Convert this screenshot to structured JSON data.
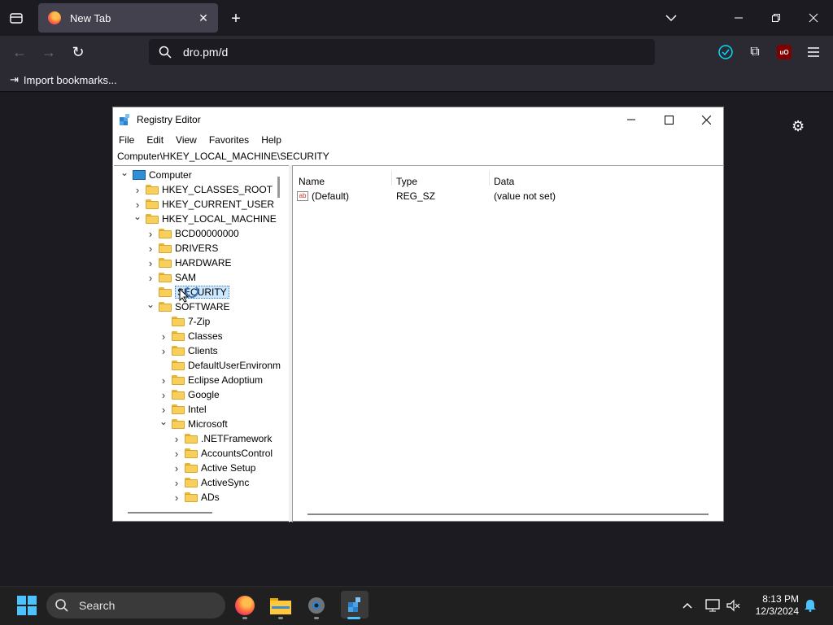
{
  "browser": {
    "tab_title": "New Tab",
    "url": "dro.pm/d",
    "bookmark_import": "Import bookmarks...",
    "colors": {
      "chrome_bg": "#1c1b22",
      "toolbar_bg": "#2b2a33",
      "accent": "#00ddff"
    }
  },
  "regedit": {
    "title": "Registry Editor",
    "menu": [
      "File",
      "Edit",
      "View",
      "Favorites",
      "Help"
    ],
    "address": "Computer\\HKEY_LOCAL_MACHINE\\SECURITY",
    "tree": [
      {
        "label": "Computer",
        "expanded": "down"
      },
      {
        "label": "HKEY_CLASSES_ROOT",
        "expanded": "right"
      },
      {
        "label": "HKEY_CURRENT_USER",
        "expanded": "right"
      },
      {
        "label": "HKEY_LOCAL_MACHINE",
        "expanded": "down"
      },
      {
        "label": "BCD00000000",
        "expanded": "right"
      },
      {
        "label": "DRIVERS",
        "expanded": "right"
      },
      {
        "label": "HARDWARE",
        "expanded": "right"
      },
      {
        "label": "SAM",
        "expanded": "right"
      },
      {
        "label": "SECURITY",
        "expanded": "none",
        "selected": true
      },
      {
        "label": "SOFTWARE",
        "expanded": "down"
      },
      {
        "label": "7-Zip",
        "expanded": "none"
      },
      {
        "label": "Classes",
        "expanded": "right"
      },
      {
        "label": "Clients",
        "expanded": "right"
      },
      {
        "label": "DefaultUserEnvironm",
        "expanded": "none"
      },
      {
        "label": "Eclipse Adoptium",
        "expanded": "right"
      },
      {
        "label": "Google",
        "expanded": "right"
      },
      {
        "label": "Intel",
        "expanded": "right"
      },
      {
        "label": "Microsoft",
        "expanded": "down"
      },
      {
        "label": ".NETFramework",
        "expanded": "right"
      },
      {
        "label": "AccountsControl",
        "expanded": "right"
      },
      {
        "label": "Active Setup",
        "expanded": "right"
      },
      {
        "label": "ActiveSync",
        "expanded": "right"
      },
      {
        "label": "ADs",
        "expanded": "right"
      }
    ],
    "columns": [
      "Name",
      "Type",
      "Data"
    ],
    "values": [
      {
        "name": "(Default)",
        "type": "REG_SZ",
        "data": "(value not set)"
      }
    ]
  },
  "taskbar": {
    "search_label": "Search",
    "time": "8:13 PM",
    "date": "12/3/2024"
  }
}
